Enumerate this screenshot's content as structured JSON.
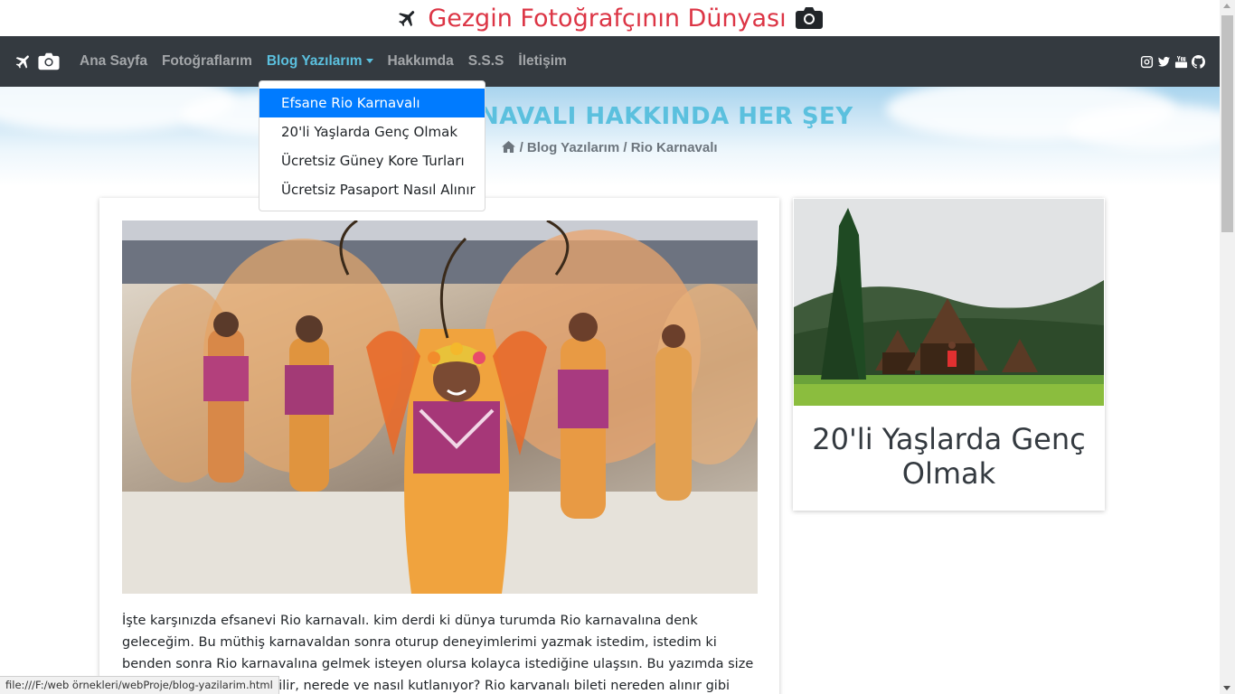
{
  "header": {
    "title": "Gezgin Fotoğrafçının Dünyası",
    "title_color": "#dc3545"
  },
  "nav": {
    "brand_icons": [
      "plane-icon",
      "camera-icon"
    ],
    "items": [
      {
        "label": "Ana Sayfa"
      },
      {
        "label": "Fotoğraflarım"
      },
      {
        "label": "Blog Yazılarım",
        "active": true
      },
      {
        "label": "Hakkımda"
      },
      {
        "label": "S.S.S"
      },
      {
        "label": "İletişim"
      }
    ],
    "social_icons": [
      "instagram-icon",
      "twitter-icon",
      "youtube-icon",
      "github-icon"
    ],
    "active_color": "#5bc0de"
  },
  "dropdown": {
    "items": [
      {
        "label": "Efsane Rio Karnavalı",
        "active": true
      },
      {
        "label": "20'li Yaşlarda Genç Olmak"
      },
      {
        "label": "Ücretsiz Güney Kore Turları"
      },
      {
        "label": "Ücretsiz Pasaport Nasıl Alınır"
      }
    ]
  },
  "hero": {
    "title": "RİO KARNAVALI HAKKINDA HER ŞEY",
    "breadcrumb": {
      "home_icon": "home-icon",
      "items": [
        "Blog Yazılarım",
        "Rio Karnavalı"
      ]
    }
  },
  "article": {
    "text": "İşte karşınızda efsanevi Rio karnavalı. kim derdi ki dünya turumda Rio karnavalına denk geleceğim. Bu müthiş karnavaldan sonra oturup deneyimlerimi yazmak istedim, istedim ki benden sonra Rio karnavalına gelmek isteyen olursa kolayca istediğine ulaşsın. Bu yazımda size rio karnavalına nasıl gidilir, nerede ve nasıl kutlanıyor? Rio karvanalı bileti nereden alınır gibi tüm sorulara"
  },
  "sidebar": {
    "card_title": "20'li Yaşlarda Genç Olmak"
  },
  "status_bar": {
    "url": "file:///F:/web örnekleri/webProje/blog-yazilarim.html"
  }
}
